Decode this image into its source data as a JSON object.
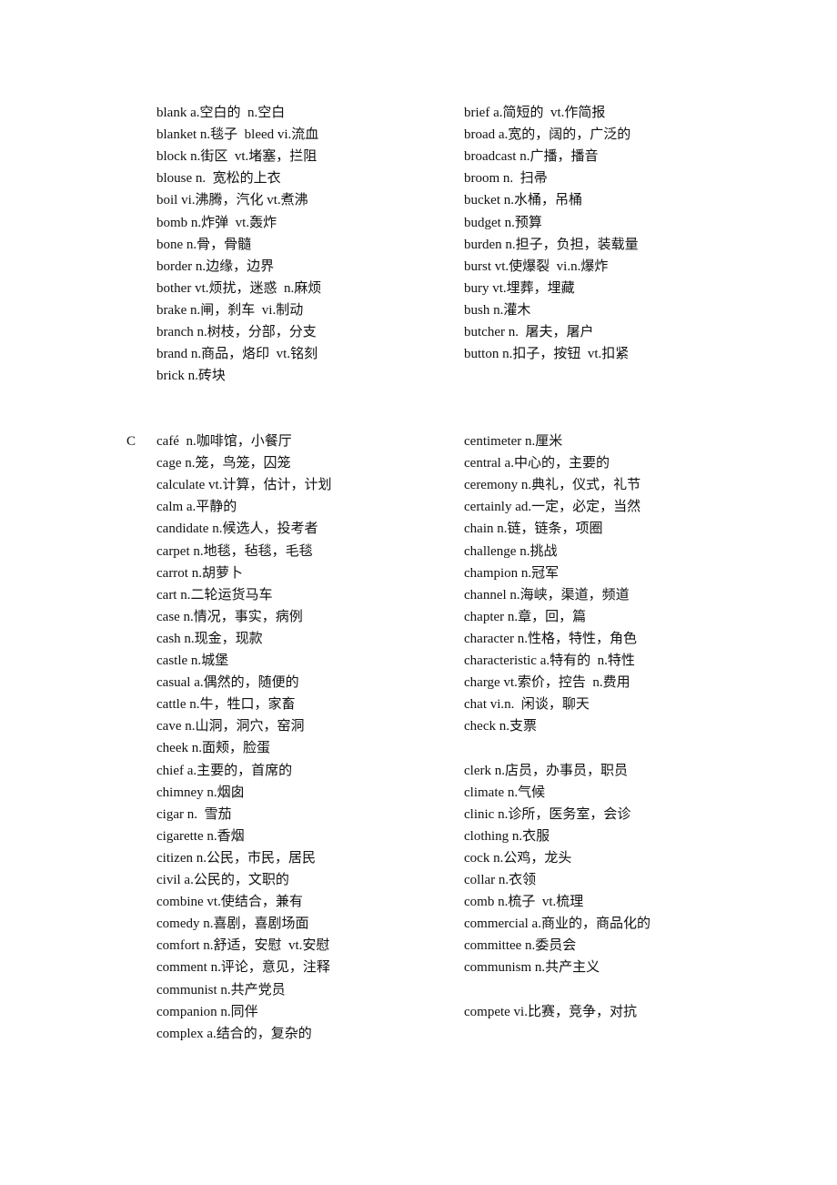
{
  "document": {
    "block_b": {
      "left": [
        "blank a.空白的  n.空白",
        "blanket n.毯子  bleed vi.流血",
        "block n.街区  vt.堵塞，拦阻",
        "blouse n.  宽松的上衣",
        "boil vi.沸腾，汽化 vt.煮沸",
        "bomb n.炸弹  vt.轰炸",
        "bone n.骨，骨髓",
        "border n.边缘，边界",
        "bother vt.烦扰，迷惑  n.麻烦",
        "brake n.闸，刹车  vi.制动",
        "branch n.树枝，分部，分支",
        "brand n.商品，烙印  vt.铭刻",
        "brick n.砖块"
      ],
      "right": [
        "brief a.简短的  vt.作简报",
        "broad a.宽的，阔的，广泛的",
        "broadcast n.广播，播音",
        "broom n.  扫帚",
        "bucket n.水桶，吊桶",
        "budget n.预算",
        "burden n.担子，负担，装载量",
        "burst vt.使爆裂  vi.n.爆炸",
        "bury vt.埋葬，埋藏",
        "bush n.灌木",
        "butcher n.  屠夫，屠户",
        "button n.扣子，按钮  vt.扣紧"
      ]
    },
    "block_c": {
      "letter": "C",
      "left": [
        "café  n.咖啡馆，小餐厅",
        "cage n.笼，鸟笼，囚笼",
        "calculate vt.计算，估计，计划",
        "calm a.平静的",
        "candidate n.候选人，投考者",
        "carpet n.地毯，毡毯，毛毯",
        "carrot n.胡萝卜",
        "cart n.二轮运货马车",
        "case n.情况，事实，病例",
        "cash n.现金，现款",
        "castle n.城堡",
        "casual a.偶然的，随便的",
        "cattle n.牛，牲口，家畜",
        "cave n.山洞，洞穴，窑洞",
        "cheek n.面颊，脸蛋",
        "chief a.主要的，首席的",
        "chimney n.烟囱",
        "cigar n.  雪茄",
        "cigarette n.香烟",
        "citizen n.公民，市民，居民",
        "civil a.公民的，文职的",
        "combine vt.使结合，兼有",
        "comedy n.喜剧，喜剧场面",
        "comfort n.舒适，安慰  vt.安慰",
        "comment n.评论，意见，注释",
        "communist n.共产党员",
        "companion n.同伴",
        "complex a.结合的，复杂的"
      ],
      "right": [
        "centimeter n.厘米",
        "central a.中心的，主要的",
        "ceremony n.典礼，仪式，礼节",
        "certainly ad.一定，必定，当然",
        "chain n.链，链条，项圈",
        "challenge n.挑战",
        "champion n.冠军",
        "channel n.海峡，渠道，频道",
        "chapter n.章，回，篇",
        "character n.性格，特性，角色",
        "characteristic a.特有的  n.特性",
        "charge vt.索价，控告  n.费用",
        "chat vi.n.  闲谈，聊天",
        "check n.支票",
        "",
        "clerk n.店员，办事员，职员",
        "climate n.气候",
        "clinic n.诊所，医务室，会诊",
        "clothing n.衣服",
        "cock n.公鸡，龙头",
        "collar n.衣领",
        "comb n.梳子  vt.梳理",
        "commercial a.商业的，商品化的",
        "committee n.委员会",
        "communism n.共产主义",
        "",
        "compete vi.比赛，竞争，对抗"
      ]
    }
  }
}
